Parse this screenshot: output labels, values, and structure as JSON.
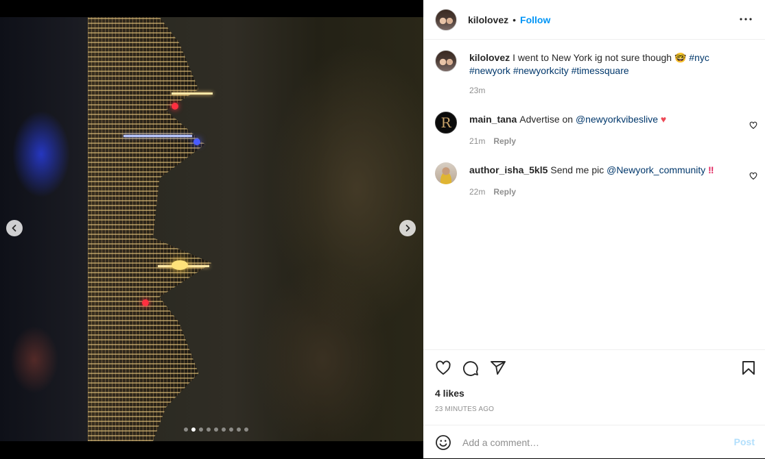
{
  "post": {
    "username": "kilolovez",
    "separator": "•",
    "follow_label": "Follow",
    "likes": "4 likes",
    "timestamp": "23 MINUTES AGO",
    "media": {
      "carousel_count": 9,
      "active_index": 1
    }
  },
  "caption": {
    "username": "kilolovez",
    "text": "I went to New York ig not sure though",
    "emoji": "🤓",
    "hashtags": [
      "#nyc",
      "#newyork",
      "#newyorkcity",
      "#timessquare"
    ],
    "time": "23m"
  },
  "comments": [
    {
      "username": "main_tana",
      "text": "Advertise on",
      "mention": "@newyorkvibeslive",
      "suffix": "♥",
      "time": "21m",
      "reply_label": "Reply",
      "avatar_letter": "R"
    },
    {
      "username": "author_isha_5kl5",
      "text": "Send me pic",
      "mention": "@Newyork_community",
      "suffix": "‼",
      "time": "22m",
      "reply_label": "Reply"
    }
  ],
  "add_comment": {
    "placeholder": "Add a comment…",
    "post_label": "Post"
  },
  "colors": {
    "accent": "#0095f6",
    "link": "#00376b",
    "muted": "#8e8e8e",
    "text": "#262626",
    "heart": "#ed4956"
  },
  "icons": [
    "chevron-left-icon",
    "chevron-right-icon",
    "more-icon",
    "heart-icon",
    "comment-icon",
    "share-icon",
    "bookmark-icon",
    "emoji-icon"
  ]
}
